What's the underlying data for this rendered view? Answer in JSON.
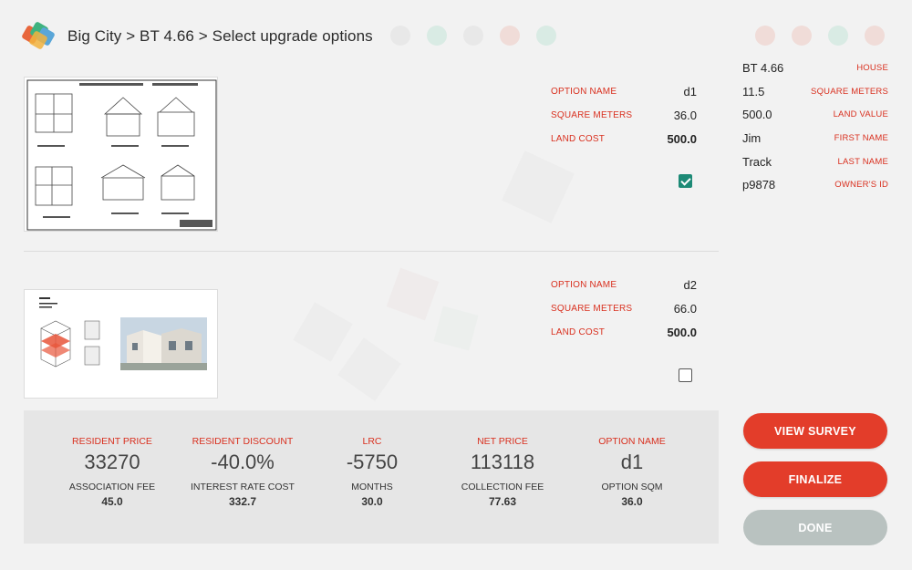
{
  "header": {
    "breadcrumb": "Big City > BT 4.66 > Select upgrade options"
  },
  "options": [
    {
      "name_label": "OPTION NAME",
      "name_value": "d1",
      "sqm_label": "SQUARE METERS",
      "sqm_value": "36.0",
      "land_label": "LAND COST",
      "land_value": "500.0",
      "selected": true
    },
    {
      "name_label": "OPTION NAME",
      "name_value": "d2",
      "sqm_label": "SQUARE METERS",
      "sqm_value": "66.0",
      "land_label": "LAND COST",
      "land_value": "500.0",
      "selected": false
    }
  ],
  "info": [
    {
      "value": "BT 4.66",
      "label": "HOUSE"
    },
    {
      "value": "11.5",
      "label": "SQUARE METERS"
    },
    {
      "value": "500.0",
      "label": "LAND VALUE"
    },
    {
      "value": "Jim",
      "label": "FIRST NAME"
    },
    {
      "value": "Track",
      "label": "LAST NAME"
    },
    {
      "value": "p9878",
      "label": "OWNER'S ID"
    }
  ],
  "summary": [
    {
      "label": "RESIDENT PRICE",
      "value": "33270",
      "sublabel": "ASSOCIATION FEE",
      "subvalue": "45.0"
    },
    {
      "label": "RESIDENT DISCOUNT",
      "value": "-40.0%",
      "sublabel": "INTEREST RATE COST",
      "subvalue": "332.7"
    },
    {
      "label": "LRC",
      "value": "-5750",
      "sublabel": "MONTHS",
      "subvalue": "30.0"
    },
    {
      "label": "NET PRICE",
      "value": "113118",
      "sublabel": "COLLECTION FEE",
      "subvalue": "77.63"
    },
    {
      "label": "OPTION NAME",
      "value": "d1",
      "sublabel": "OPTION SQM",
      "subvalue": "36.0"
    }
  ],
  "buttons": {
    "view_survey": "VIEW SURVEY",
    "finalize": "FINALIZE",
    "done": "DONE"
  },
  "colors": {
    "accent_red": "#e33d2a",
    "label_red": "#d9301f",
    "check_green": "#1d8a76",
    "disabled_grey": "#b9c2c0"
  }
}
